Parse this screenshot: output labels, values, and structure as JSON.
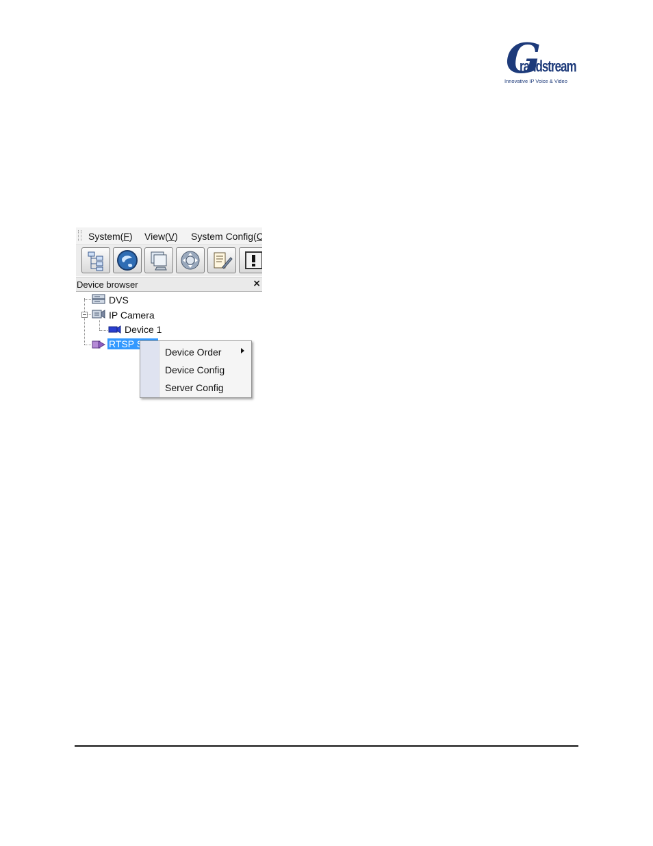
{
  "logo": {
    "letter": "G",
    "word": "randstream",
    "tagline": "Innovative IP Voice & Video"
  },
  "menubar": {
    "items": [
      {
        "label": "System(",
        "key": "F",
        "tail": ")"
      },
      {
        "label": "View(",
        "key": "V",
        "tail": ")"
      },
      {
        "label": "System Config(",
        "key": "C",
        "tail": ""
      }
    ]
  },
  "toolbar": {
    "buttons": [
      {
        "icon": "device-tree-icon"
      },
      {
        "icon": "globe-icon"
      },
      {
        "icon": "monitor-icon"
      },
      {
        "icon": "ptz-control-icon"
      },
      {
        "icon": "log-notepad-icon"
      },
      {
        "icon": "alarm-icon"
      }
    ]
  },
  "device_browser": {
    "title": "Device browser",
    "close": "×",
    "tree": [
      {
        "label": "DVS",
        "icon": "dvs-icon"
      },
      {
        "label": "IP Camera",
        "icon": "ip-camera-icon",
        "expanded": true,
        "children": [
          {
            "label": "Device 1",
            "icon": "camera-icon"
          }
        ]
      },
      {
        "label": "RTSP S",
        "icon": "rtsp-server-icon",
        "selected": true
      }
    ]
  },
  "context_menu": {
    "items": [
      {
        "label": "Device Order",
        "submenu": true
      },
      {
        "label": "Device Config",
        "submenu": false
      },
      {
        "label": "Server Config",
        "submenu": false
      }
    ]
  }
}
